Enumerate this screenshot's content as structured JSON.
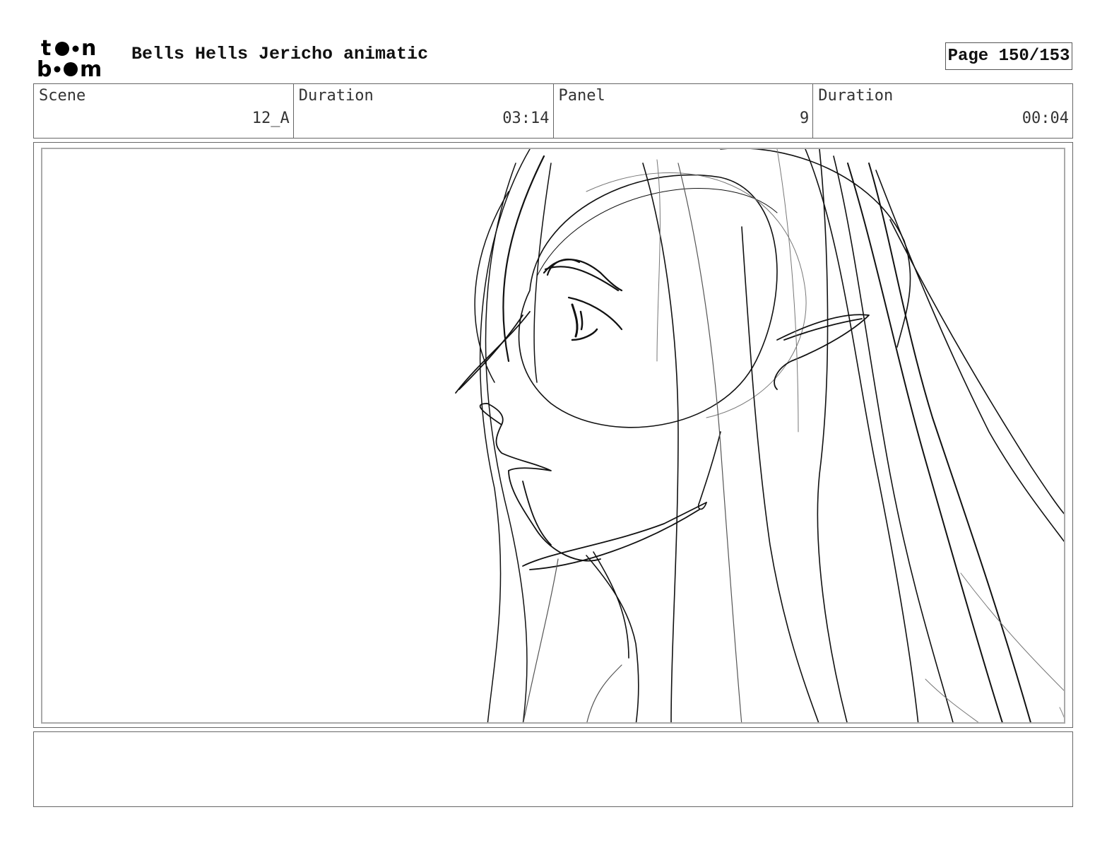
{
  "header": {
    "logo_top": "t●•n",
    "logo_bottom": "b•●m",
    "title": "Bells Hells Jericho animatic",
    "page_label": "Page 150/153"
  },
  "info": {
    "scene_label": "Scene",
    "scene_value": "12_A",
    "scene_duration_label": "Duration",
    "scene_duration_value": "03:14",
    "panel_label": "Panel",
    "panel_value": "9",
    "panel_duration_label": "Duration",
    "panel_duration_value": "00:04"
  },
  "panel": {
    "image": "rough-pencil-sketch-elf-profile"
  },
  "notes": {
    "text": ""
  }
}
